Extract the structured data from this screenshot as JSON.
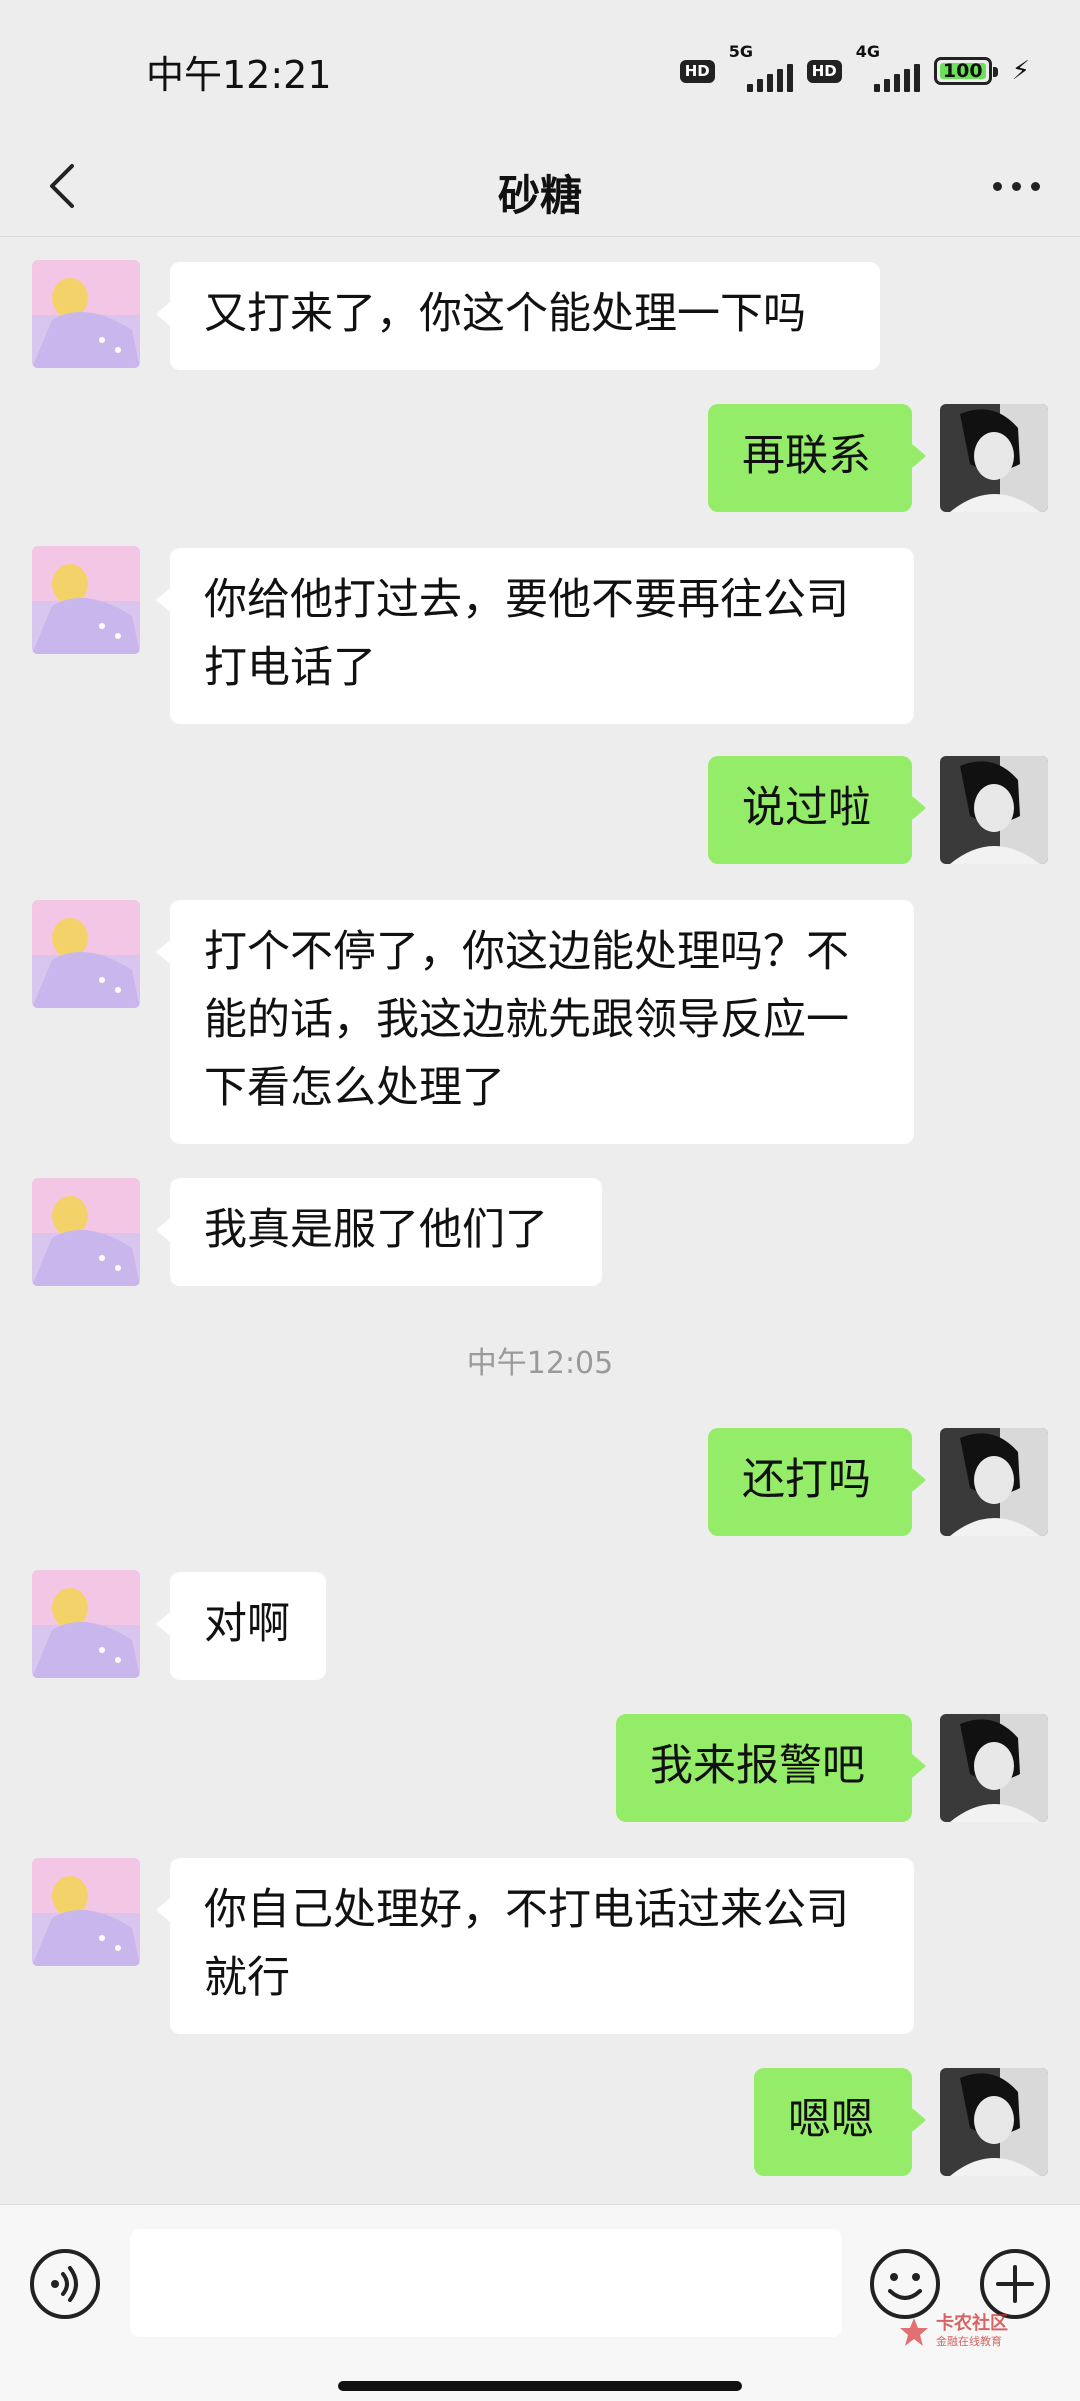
{
  "status_bar": {
    "time": "中午12:21",
    "hd1": "HD",
    "net1": "5G",
    "hd2": "HD",
    "net2": "4G",
    "battery": "100"
  },
  "nav": {
    "title": "砂糖",
    "back_icon": "chevron-left-icon",
    "more_icon": "more-horizontal-icon"
  },
  "messages": [
    {
      "from": "other",
      "text": "又打来了，你这个能处理一下吗"
    },
    {
      "from": "me",
      "text": "再联系"
    },
    {
      "from": "other",
      "text": "你给他打过去，要他不要再往公司打电话了"
    },
    {
      "from": "me",
      "text": "说过啦"
    },
    {
      "from": "other",
      "text": "打个不停了，你这边能处理吗？不能的话，我这边就先跟领导反应一下看怎么处理了"
    },
    {
      "from": "other",
      "text": "我真是服了他们了"
    },
    {
      "from": "me",
      "text": "还打吗"
    },
    {
      "from": "other",
      "text": "对啊"
    },
    {
      "from": "me",
      "text": "我来报警吧"
    },
    {
      "from": "other",
      "text": "你自己处理好，不打电话过来公司就行"
    },
    {
      "from": "me",
      "text": "嗯嗯"
    }
  ],
  "timestamp": "中午12:05",
  "input_bar": {
    "placeholder": "",
    "voice_icon": "voice-icon",
    "emoji_icon": "emoji-icon",
    "plus_icon": "plus-circle-icon"
  },
  "watermark": {
    "title": "卡农社区",
    "subtitle": "金融在线教育"
  },
  "colors": {
    "background": "#ededed",
    "sent_bubble": "#95ec69",
    "received_bubble": "#ffffff",
    "battery": "#6be05a"
  }
}
